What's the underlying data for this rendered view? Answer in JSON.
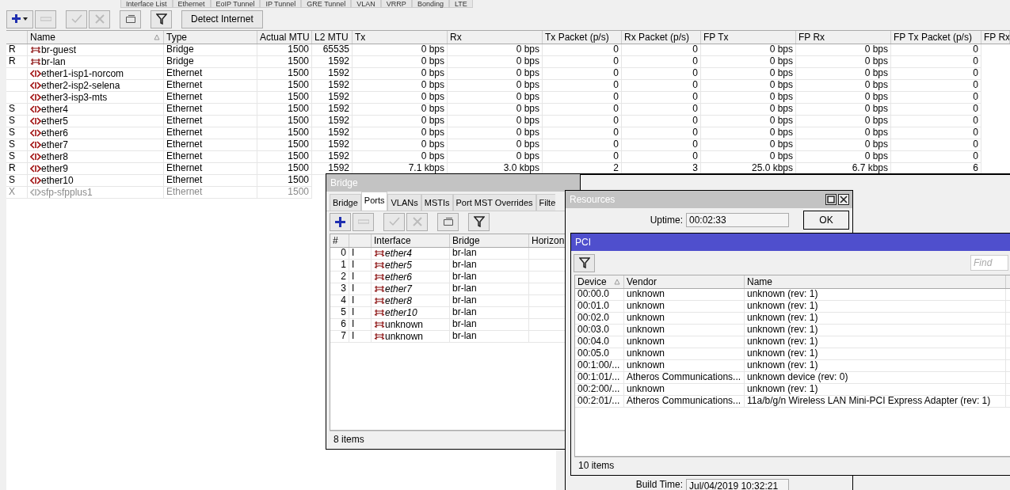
{
  "top_tabs": [
    "Interface List",
    "Ethernet",
    "EoIP Tunnel",
    "IP Tunnel",
    "GRE Tunnel",
    "VLAN",
    "VRRP",
    "Bonding",
    "LTE"
  ],
  "toolbar": {
    "detect_button": "Detect Internet"
  },
  "interfaces": {
    "columns": [
      "",
      "Name",
      "Type",
      "Actual MTU",
      "L2 MTU",
      "Tx",
      "Rx",
      "Tx Packet (p/s)",
      "Rx Packet (p/s)",
      "FP Tx",
      "FP Rx",
      "FP Tx Packet (p/s)",
      "FP Rx"
    ],
    "rows": [
      {
        "kind": "bridge",
        "disabled": false,
        "cells": [
          "R",
          "br-guest",
          "Bridge",
          "1500",
          "65535",
          "0 bps",
          "0 bps",
          "0",
          "0",
          "0 bps",
          "0 bps",
          "0"
        ]
      },
      {
        "kind": "bridge",
        "disabled": false,
        "cells": [
          "R",
          "br-lan",
          "Bridge",
          "1500",
          "1592",
          "0 bps",
          "0 bps",
          "0",
          "0",
          "0 bps",
          "0 bps",
          "0"
        ]
      },
      {
        "kind": "ethernet",
        "disabled": false,
        "cells": [
          "",
          "ether1-isp1-norcom",
          "Ethernet",
          "1500",
          "1592",
          "0 bps",
          "0 bps",
          "0",
          "0",
          "0 bps",
          "0 bps",
          "0"
        ]
      },
      {
        "kind": "ethernet",
        "disabled": false,
        "cells": [
          "",
          "ether2-isp2-selena",
          "Ethernet",
          "1500",
          "1592",
          "0 bps",
          "0 bps",
          "0",
          "0",
          "0 bps",
          "0 bps",
          "0"
        ]
      },
      {
        "kind": "ethernet",
        "disabled": false,
        "cells": [
          "",
          "ether3-isp3-mts",
          "Ethernet",
          "1500",
          "1592",
          "0 bps",
          "0 bps",
          "0",
          "0",
          "0 bps",
          "0 bps",
          "0"
        ]
      },
      {
        "kind": "ethernet",
        "disabled": false,
        "cells": [
          "S",
          "ether4",
          "Ethernet",
          "1500",
          "1592",
          "0 bps",
          "0 bps",
          "0",
          "0",
          "0 bps",
          "0 bps",
          "0"
        ]
      },
      {
        "kind": "ethernet",
        "disabled": false,
        "cells": [
          "S",
          "ether5",
          "Ethernet",
          "1500",
          "1592",
          "0 bps",
          "0 bps",
          "0",
          "0",
          "0 bps",
          "0 bps",
          "0"
        ]
      },
      {
        "kind": "ethernet",
        "disabled": false,
        "cells": [
          "S",
          "ether6",
          "Ethernet",
          "1500",
          "1592",
          "0 bps",
          "0 bps",
          "0",
          "0",
          "0 bps",
          "0 bps",
          "0"
        ]
      },
      {
        "kind": "ethernet",
        "disabled": false,
        "cells": [
          "S",
          "ether7",
          "Ethernet",
          "1500",
          "1592",
          "0 bps",
          "0 bps",
          "0",
          "0",
          "0 bps",
          "0 bps",
          "0"
        ]
      },
      {
        "kind": "ethernet",
        "disabled": false,
        "cells": [
          "S",
          "ether8",
          "Ethernet",
          "1500",
          "1592",
          "0 bps",
          "0 bps",
          "0",
          "0",
          "0 bps",
          "0 bps",
          "0"
        ]
      },
      {
        "kind": "ethernet",
        "disabled": false,
        "cells": [
          "R",
          "ether9",
          "Ethernet",
          "1500",
          "1592",
          "7.1 kbps",
          "3.0 kbps",
          "2",
          "3",
          "25.0 kbps",
          "6.7 kbps",
          "6"
        ]
      },
      {
        "kind": "ethernet",
        "disabled": false,
        "cells": [
          "S",
          "ether10",
          "Ethernet",
          "1500"
        ]
      },
      {
        "kind": "ethernet",
        "disabled": true,
        "cells": [
          "X",
          "sfp-sfpplus1",
          "Ethernet",
          "1500"
        ]
      }
    ]
  },
  "bridge_window": {
    "title": "Bridge",
    "tabs": [
      {
        "label": "Bridge",
        "selected": false
      },
      {
        "label": "Ports",
        "selected": true
      },
      {
        "label": "VLANs",
        "selected": false
      },
      {
        "label": "MSTIs",
        "selected": false
      },
      {
        "label": "Port MST Overrides",
        "selected": false
      },
      {
        "label": "Filte",
        "selected": false
      }
    ],
    "columns": [
      "#",
      "Interface",
      "Bridge",
      "Horizon"
    ],
    "rows": [
      {
        "index": "0",
        "flag": "I",
        "interface": "ether4",
        "inactive": true,
        "bridge": "br-lan"
      },
      {
        "index": "1",
        "flag": "I",
        "interface": "ether5",
        "inactive": true,
        "bridge": "br-lan"
      },
      {
        "index": "2",
        "flag": "I",
        "interface": "ether6",
        "inactive": true,
        "bridge": "br-lan"
      },
      {
        "index": "3",
        "flag": "I",
        "interface": "ether7",
        "inactive": true,
        "bridge": "br-lan"
      },
      {
        "index": "4",
        "flag": "I",
        "interface": "ether8",
        "inactive": true,
        "bridge": "br-lan"
      },
      {
        "index": "5",
        "flag": "I",
        "interface": "ether10",
        "inactive": true,
        "bridge": "br-lan"
      },
      {
        "index": "6",
        "flag": "I",
        "interface": "unknown",
        "inactive": false,
        "bridge": "br-lan"
      },
      {
        "index": "7",
        "flag": "I",
        "interface": "unknown",
        "inactive": false,
        "bridge": "br-lan"
      }
    ],
    "footer": "8 items"
  },
  "resources_window": {
    "title": "Resources",
    "uptime_label": "Uptime:",
    "uptime": "00:02:33",
    "ok_button": "OK",
    "build_time_label": "Build Time:",
    "build_time": "Jul/04/2019 10:32:21"
  },
  "pci_window": {
    "title": "PCI",
    "find_placeholder": "Find",
    "columns": [
      "Device",
      "Vendor",
      "Name"
    ],
    "rows": [
      [
        "00:00.0",
        "unknown",
        "unknown (rev: 1)"
      ],
      [
        "00:01.0",
        "unknown",
        "unknown (rev: 1)"
      ],
      [
        "00:02.0",
        "unknown",
        "unknown (rev: 1)"
      ],
      [
        "00:03.0",
        "unknown",
        "unknown (rev: 1)"
      ],
      [
        "00:04.0",
        "unknown",
        "unknown (rev: 1)"
      ],
      [
        "00:05.0",
        "unknown",
        "unknown (rev: 1)"
      ],
      [
        "00:1:00/...",
        "unknown",
        "unknown (rev: 1)"
      ],
      [
        "00:1:01/...",
        "Atheros Communications...",
        "unknown device (rev: 0)"
      ],
      [
        "00:2:00/...",
        "unknown",
        "unknown (rev: 1)"
      ],
      [
        "00:2:01/...",
        "Atheros Communications...",
        "11a/b/g/n Wireless LAN Mini-PCI Express Adapter (rev: 1)"
      ]
    ],
    "footer": "10 items"
  }
}
